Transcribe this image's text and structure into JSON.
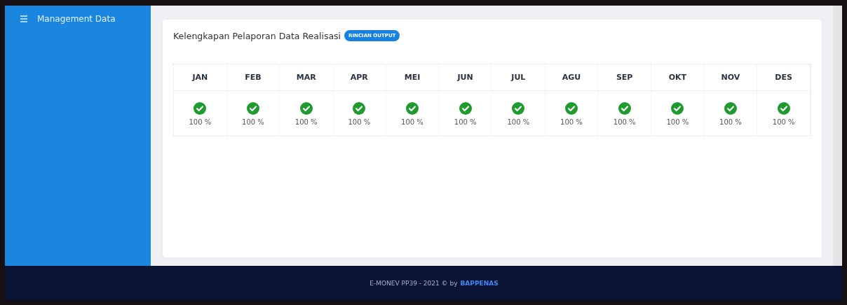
{
  "sidebar": {
    "title": "Management Data"
  },
  "card": {
    "title": "Kelengkapan Pelaporan Data Realisasi",
    "badge": "RINCIAN OUTPUT"
  },
  "months": [
    {
      "label": "JAN",
      "complete": true,
      "percent": "100 %"
    },
    {
      "label": "FEB",
      "complete": true,
      "percent": "100 %"
    },
    {
      "label": "MAR",
      "complete": true,
      "percent": "100 %"
    },
    {
      "label": "APR",
      "complete": true,
      "percent": "100 %"
    },
    {
      "label": "MEI",
      "complete": true,
      "percent": "100 %"
    },
    {
      "label": "JUN",
      "complete": true,
      "percent": "100 %"
    },
    {
      "label": "JUL",
      "complete": true,
      "percent": "100 %"
    },
    {
      "label": "AGU",
      "complete": true,
      "percent": "100 %"
    },
    {
      "label": "SEP",
      "complete": true,
      "percent": "100 %"
    },
    {
      "label": "OKT",
      "complete": true,
      "percent": "100 %"
    },
    {
      "label": "NOV",
      "complete": true,
      "percent": "100 %"
    },
    {
      "label": "DES",
      "complete": true,
      "percent": "100 %"
    }
  ],
  "footer": {
    "text": "E-MONEV PP39 - 2021 © by",
    "link": "BAPPENAS"
  }
}
